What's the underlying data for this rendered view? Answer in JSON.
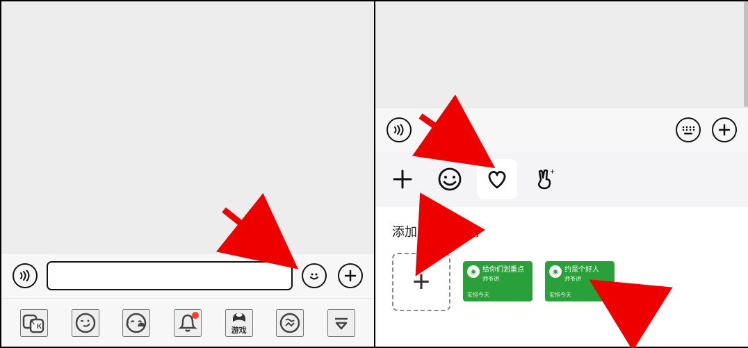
{
  "left": {
    "input_value": "",
    "input_placeholder": "",
    "icons": {
      "voice": "voice-icon",
      "emoji": "smile-icon",
      "plus": "plus-icon"
    },
    "tabs": [
      "kk-icon",
      "wink-icon",
      "yawn-icon",
      "bell-icon",
      "games-icon",
      "image-circle-icon",
      "collapse-icon"
    ],
    "games_label": "游戏"
  },
  "right": {
    "icons": {
      "voice": "voice-icon",
      "keyboard": "keyboard-icon",
      "plus": "plus-icon"
    },
    "categories": {
      "add": "+",
      "smile": "smile-icon",
      "heart": "heart-icon",
      "gesture": "gesture-icon"
    },
    "selected_category": "heart",
    "section_title": "添加的单个表情",
    "add_btn_glyph": "+",
    "stickers": [
      {
        "title": "给你们划重点",
        "subtitle": "师爷讲",
        "footer": "安排今天"
      },
      {
        "title": "约是个好人",
        "subtitle": "师爷讲",
        "footer": "安排今天"
      }
    ]
  },
  "annotations": {
    "arrows": 4
  }
}
